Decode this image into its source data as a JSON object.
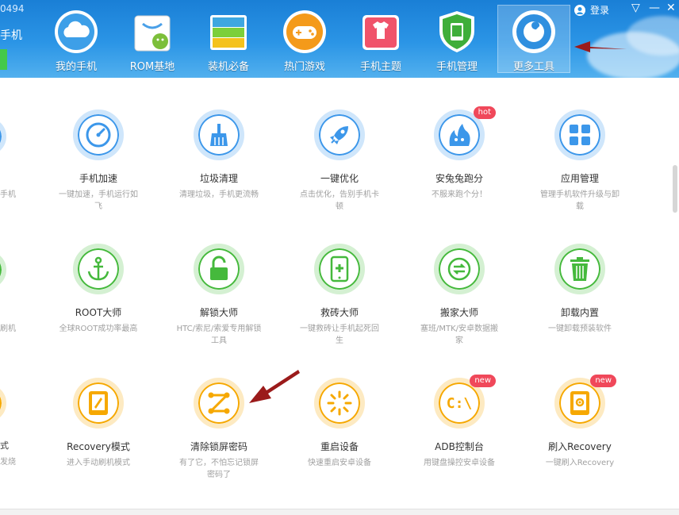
{
  "window": {
    "title_fragment": "0494"
  },
  "user_fragment": "手机",
  "header": {
    "nav": [
      {
        "label": "我的手机",
        "icon": "cloud-icon"
      },
      {
        "label": "ROM基地",
        "icon": "android-bag-icon"
      },
      {
        "label": "装机必备",
        "icon": "stack-icon"
      },
      {
        "label": "热门游戏",
        "icon": "gamepad-icon"
      },
      {
        "label": "手机主题",
        "icon": "tshirt-icon"
      },
      {
        "label": "手机管理",
        "icon": "shield-phone-icon"
      },
      {
        "label": "更多工具",
        "icon": "wrench-gear-icon",
        "active": true
      }
    ],
    "login": "登录",
    "win_controls": {
      "restore": "▽",
      "minimize": "—",
      "close": "✕"
    }
  },
  "colors": {
    "blue": "#3c97ea",
    "green": "#45b93c",
    "yellow": "#f6a800",
    "badge": "#f0485a",
    "arrow": "#9b1b1b"
  },
  "left_fragments": {
    "row1_desc": "手机",
    "row2_desc": "刷机",
    "row3_title": "式",
    "row3_desc": "发烧"
  },
  "tools": [
    [
      {
        "title": "手机加速",
        "desc": "一键加速，手机运行如飞",
        "icon": "speedometer-icon"
      },
      {
        "title": "垃圾清理",
        "desc": "清理垃圾，手机更流畅",
        "icon": "broom-icon"
      },
      {
        "title": "一键优化",
        "desc": "点击优化，告别手机卡顿",
        "icon": "rocket-icon"
      },
      {
        "title": "安兔兔跑分",
        "desc": "不服来跑个分！",
        "icon": "rabbit-flame-icon",
        "badge": "hot"
      },
      {
        "title": "应用管理",
        "desc": "管理手机软件升级与卸载",
        "icon": "grid-icon"
      }
    ],
    [
      {
        "title": "ROOT大师",
        "desc": "全球ROOT成功率最高",
        "icon": "anchor-icon"
      },
      {
        "title": "解锁大师",
        "desc": "HTC/索尼/索爱专用解锁工具",
        "icon": "unlock-icon"
      },
      {
        "title": "救砖大师",
        "desc": "一键救砖让手机起死回生",
        "icon": "phone-plus-icon"
      },
      {
        "title": "搬家大师",
        "desc": "塞班/MTK/安卓数据搬家",
        "icon": "transfer-icon"
      },
      {
        "title": "卸载内置",
        "desc": "一键卸载预装软件",
        "icon": "trash-icon"
      }
    ],
    [
      {
        "title": "Recovery模式",
        "desc": "进入手动刷机模式",
        "icon": "tablet-pen-icon"
      },
      {
        "title": "清除锁屏密码",
        "desc": "有了它，不怕忘记锁屏密码了",
        "icon": "pattern-lock-icon"
      },
      {
        "title": "重启设备",
        "desc": "快速重启安卓设备",
        "icon": "restart-icon"
      },
      {
        "title": "ADB控制台",
        "desc": "用键盘操控安卓设备",
        "icon": "console-icon",
        "badge": "new"
      },
      {
        "title": "刷入Recovery",
        "desc": "一键刷入Recovery",
        "icon": "flash-recovery-icon",
        "badge": "new"
      }
    ]
  ]
}
